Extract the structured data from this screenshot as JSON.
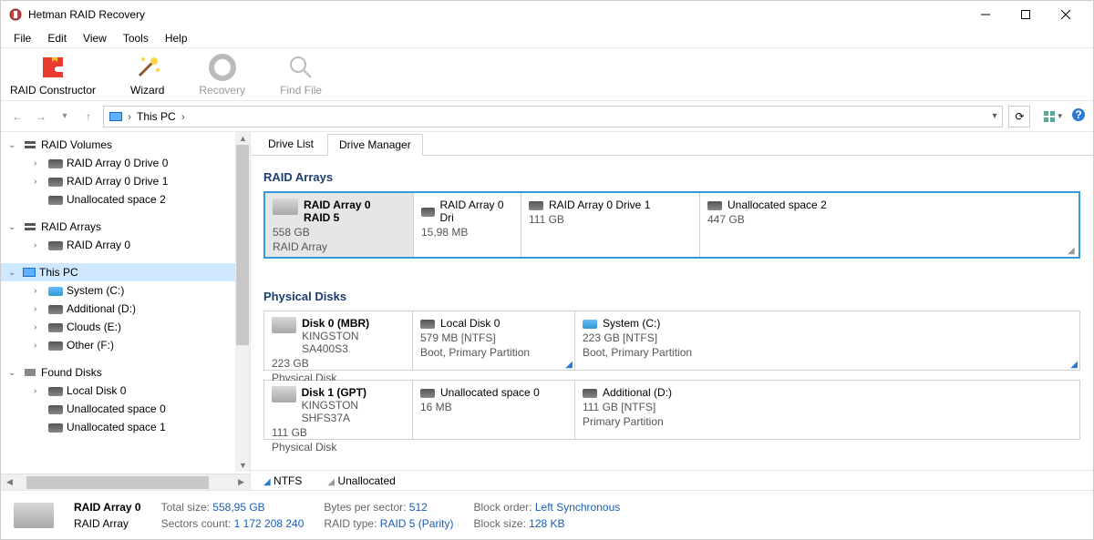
{
  "titlebar": {
    "title": "Hetman RAID Recovery"
  },
  "menubar": {
    "items": [
      "File",
      "Edit",
      "View",
      "Tools",
      "Help"
    ]
  },
  "toolbar": {
    "raid_constructor": "RAID Constructor",
    "wizard": "Wizard",
    "recovery": "Recovery",
    "find_file": "Find File"
  },
  "breadcrumb": {
    "root": "This PC"
  },
  "sidebar": {
    "groups": [
      {
        "label": "RAID Volumes",
        "children": [
          "RAID Array 0 Drive 0",
          "RAID Array 0 Drive 1",
          "Unallocated space 2"
        ]
      },
      {
        "label": "RAID Arrays",
        "children": [
          "RAID Array 0"
        ]
      },
      {
        "label": "This PC",
        "selected": true,
        "children": [
          "System (C:)",
          "Additional (D:)",
          "Clouds (E:)",
          "Other (F:)"
        ]
      },
      {
        "label": "Found Disks",
        "children": [
          "Local Disk 0",
          "Unallocated space 0",
          "Unallocated space 1"
        ]
      }
    ]
  },
  "tabs": {
    "drive_list": "Drive List",
    "drive_manager": "Drive Manager"
  },
  "sections": {
    "raid_arrays": "RAID Arrays",
    "physical_disks": "Physical Disks"
  },
  "raid": {
    "array": {
      "name": "RAID Array 0",
      "type": "RAID 5",
      "size": "558 GB",
      "kind": "RAID Array"
    },
    "parts": [
      {
        "name": "RAID Array 0 Dri",
        "size": "15,98 MB"
      },
      {
        "name": "RAID Array 0 Drive 1",
        "size": "111 GB"
      },
      {
        "name": "Unallocated space 2",
        "size": "447 GB"
      }
    ]
  },
  "disks": [
    {
      "name": "Disk 0 (MBR)",
      "model": "KINGSTON SA400S3",
      "size": "223 GB",
      "kind": "Physical Disk",
      "parts": [
        {
          "name": "Local Disk 0",
          "line1": "579 MB [NTFS]",
          "line2": "Boot, Primary Partition"
        },
        {
          "name": "System (C:)",
          "line1": "223 GB [NTFS]",
          "line2": "Boot, Primary Partition"
        }
      ]
    },
    {
      "name": "Disk 1 (GPT)",
      "model": "KINGSTON SHFS37A",
      "size": "111 GB",
      "kind": "Physical Disk",
      "parts": [
        {
          "name": "Unallocated space 0",
          "line1": "16 MB",
          "line2": ""
        },
        {
          "name": "Additional (D:)",
          "line1": "111 GB [NTFS]",
          "line2": "Primary Partition"
        }
      ]
    }
  ],
  "legend": {
    "ntfs": "NTFS",
    "unallocated": "Unallocated"
  },
  "status": {
    "name": "RAID Array 0",
    "kind": "RAID Array",
    "total_size_k": "Total size:",
    "total_size_v": "558,95 GB",
    "sectors_k": "Sectors count:",
    "sectors_v": "1 172 208 240",
    "bps_k": "Bytes per sector:",
    "bps_v": "512",
    "rtype_k": "RAID type:",
    "rtype_v": "RAID 5 (Parity)",
    "border_k": "Block order:",
    "border_v": "Left Synchronous",
    "bsize_k": "Block size:",
    "bsize_v": "128 KB"
  }
}
